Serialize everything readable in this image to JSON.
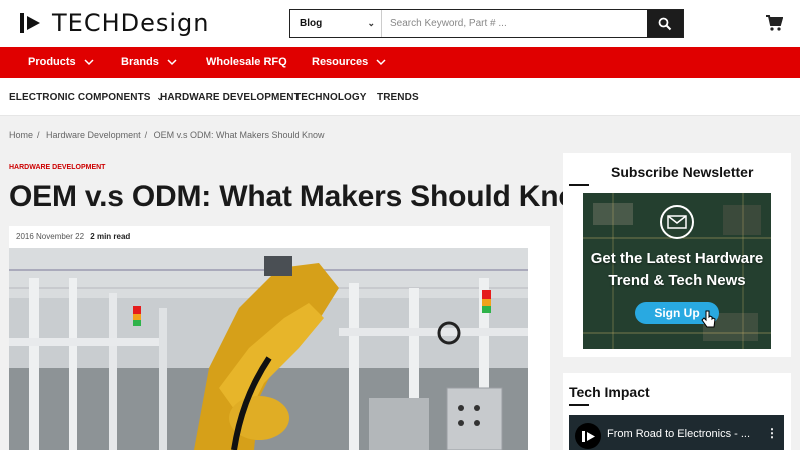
{
  "header": {
    "logo_text": "TECHDesign",
    "search": {
      "scope": "Blog",
      "placeholder": "Search Keyword, Part # ..."
    }
  },
  "main_nav": [
    {
      "label": "Products",
      "has_dropdown": true
    },
    {
      "label": "Brands",
      "has_dropdown": true
    },
    {
      "label": "Wholesale RFQ",
      "has_dropdown": false
    },
    {
      "label": "Resources",
      "has_dropdown": true
    }
  ],
  "sub_nav": [
    {
      "label": "ELECTRONIC COMPONENTS"
    },
    {
      "label": "HARDWARE DEVELOPMENT"
    },
    {
      "label": "TECHNOLOGY"
    },
    {
      "label": "TRENDS"
    }
  ],
  "breadcrumb": [
    "Home",
    "Hardware Development",
    "OEM v.s ODM: What Makers Should Know"
  ],
  "article": {
    "category": "HARDWARE DEVELOPMENT",
    "title": "OEM v.s ODM: What Makers Should Know",
    "date": "2016 November 22",
    "read_time": "2 min read"
  },
  "sidebar": {
    "newsletter": {
      "title": "Subscribe Newsletter",
      "banner_line1": "Get the Latest Hardware",
      "banner_line2": "Trend & Tech News",
      "button": "Sign Up"
    },
    "tech_impact": {
      "title": "Tech Impact",
      "video_title": "From Road to Electronics - ..."
    }
  },
  "colors": {
    "accent": "#e00000",
    "button": "#29a9e1",
    "dark": "#1c1c1c"
  }
}
